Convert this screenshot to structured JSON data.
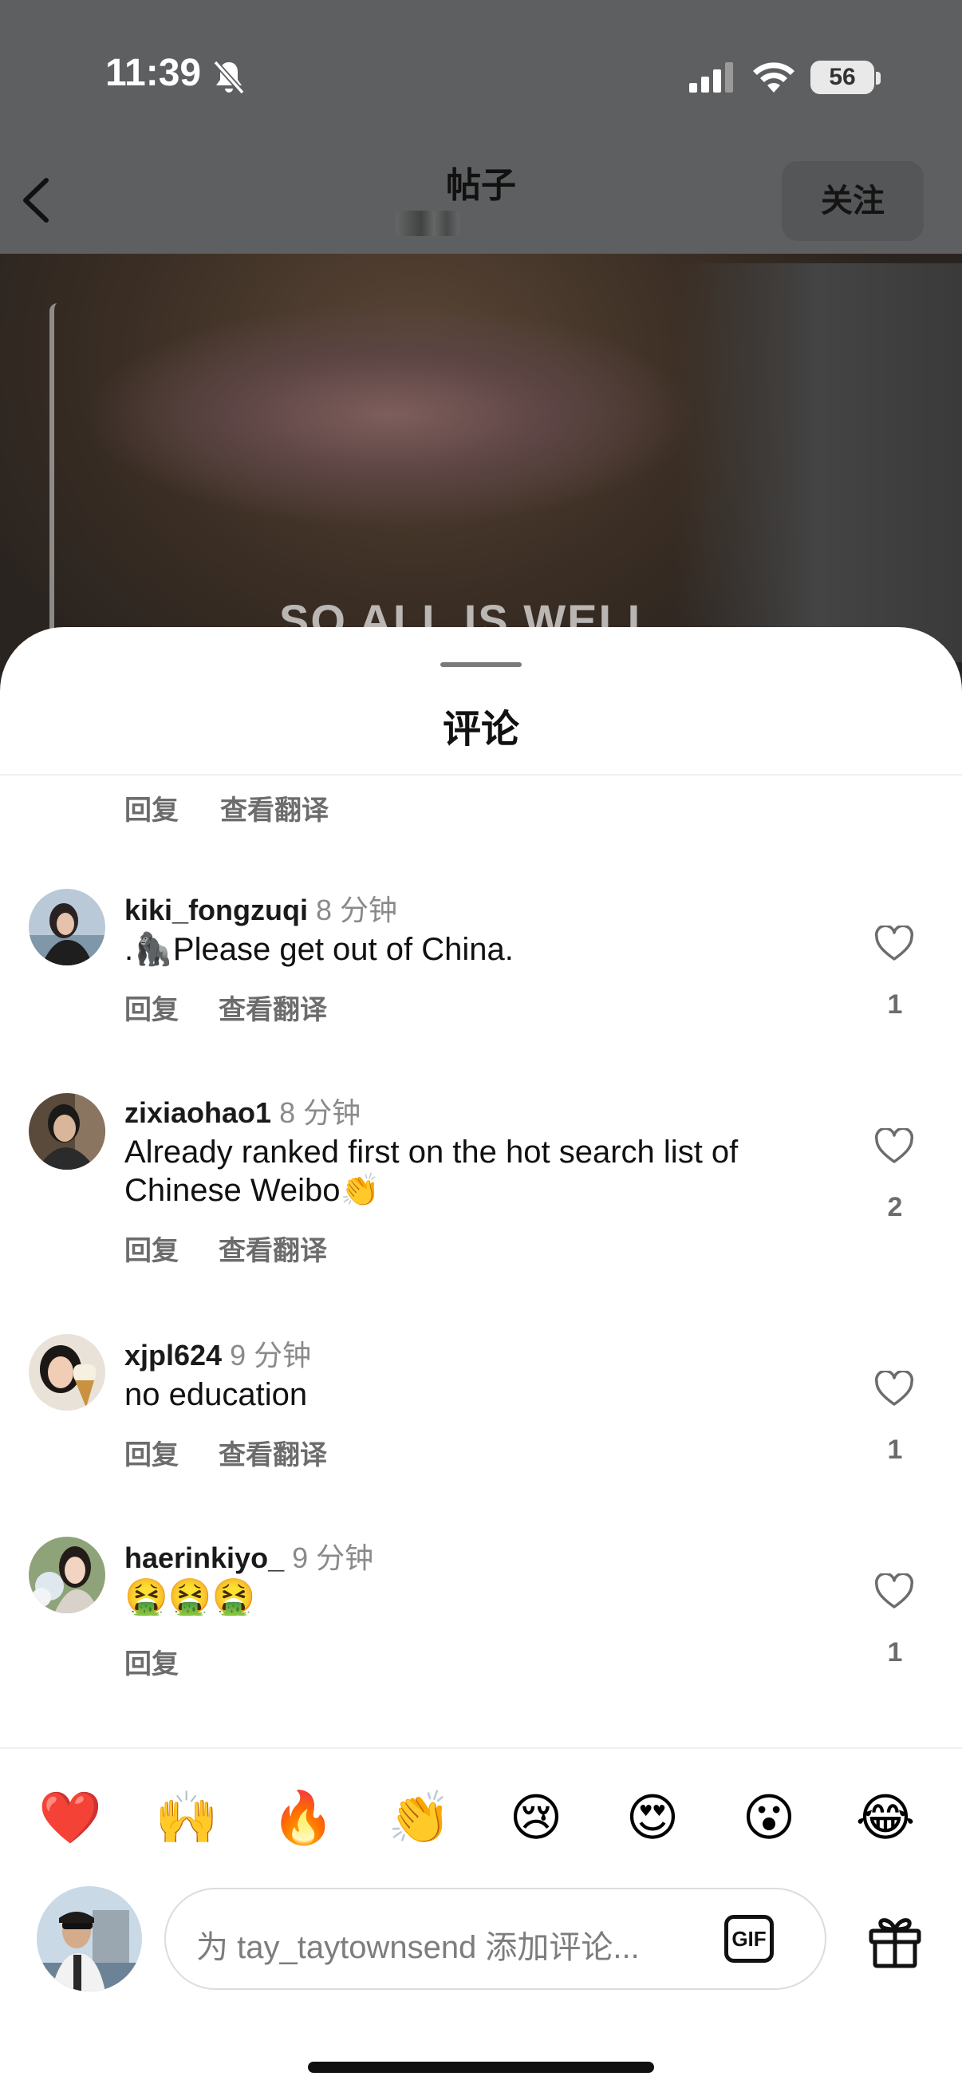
{
  "status_bar": {
    "time": "11:39",
    "battery": "56"
  },
  "header": {
    "title": "帖子",
    "follow_label": "关注"
  },
  "post": {
    "caption": "SO ALL IS WELL"
  },
  "comments_sheet": {
    "title": "评论",
    "top_actions": {
      "reply": "回复",
      "translate": "查看翻译"
    },
    "comments": [
      {
        "username": "kiki_fongzuqi",
        "time": "8 分钟",
        "text": ".🦍Please get out of China.",
        "reply": "回复",
        "translate": "查看翻译",
        "likes": "1"
      },
      {
        "username": "zixiaohao1",
        "time": "8 分钟",
        "text": "Already ranked first on the hot search list of Chinese Weibo👏",
        "reply": "回复",
        "translate": "查看翻译",
        "likes": "2"
      },
      {
        "username": "xjpl624",
        "time": "9 分钟",
        "text": "no education",
        "reply": "回复",
        "translate": "查看翻译",
        "likes": "1"
      },
      {
        "username": "haerinkiyo_",
        "time": "9 分钟",
        "text": "🤮🤮🤮",
        "reply": "回复",
        "likes": "1"
      }
    ]
  },
  "emoji_bar": [
    "❤️",
    "🙌",
    "🔥",
    "👏",
    "😢",
    "😍",
    "😮",
    "😂"
  ],
  "composer": {
    "placeholder": "为 tay_taytownsend 添加评论...",
    "gif_label": "GIF"
  },
  "colors": {
    "sheet_background": "#ffffff",
    "secondary_text": "#6c6c6c",
    "timestamp_text": "#8a8a8a",
    "overlay": "#5e5f60"
  }
}
